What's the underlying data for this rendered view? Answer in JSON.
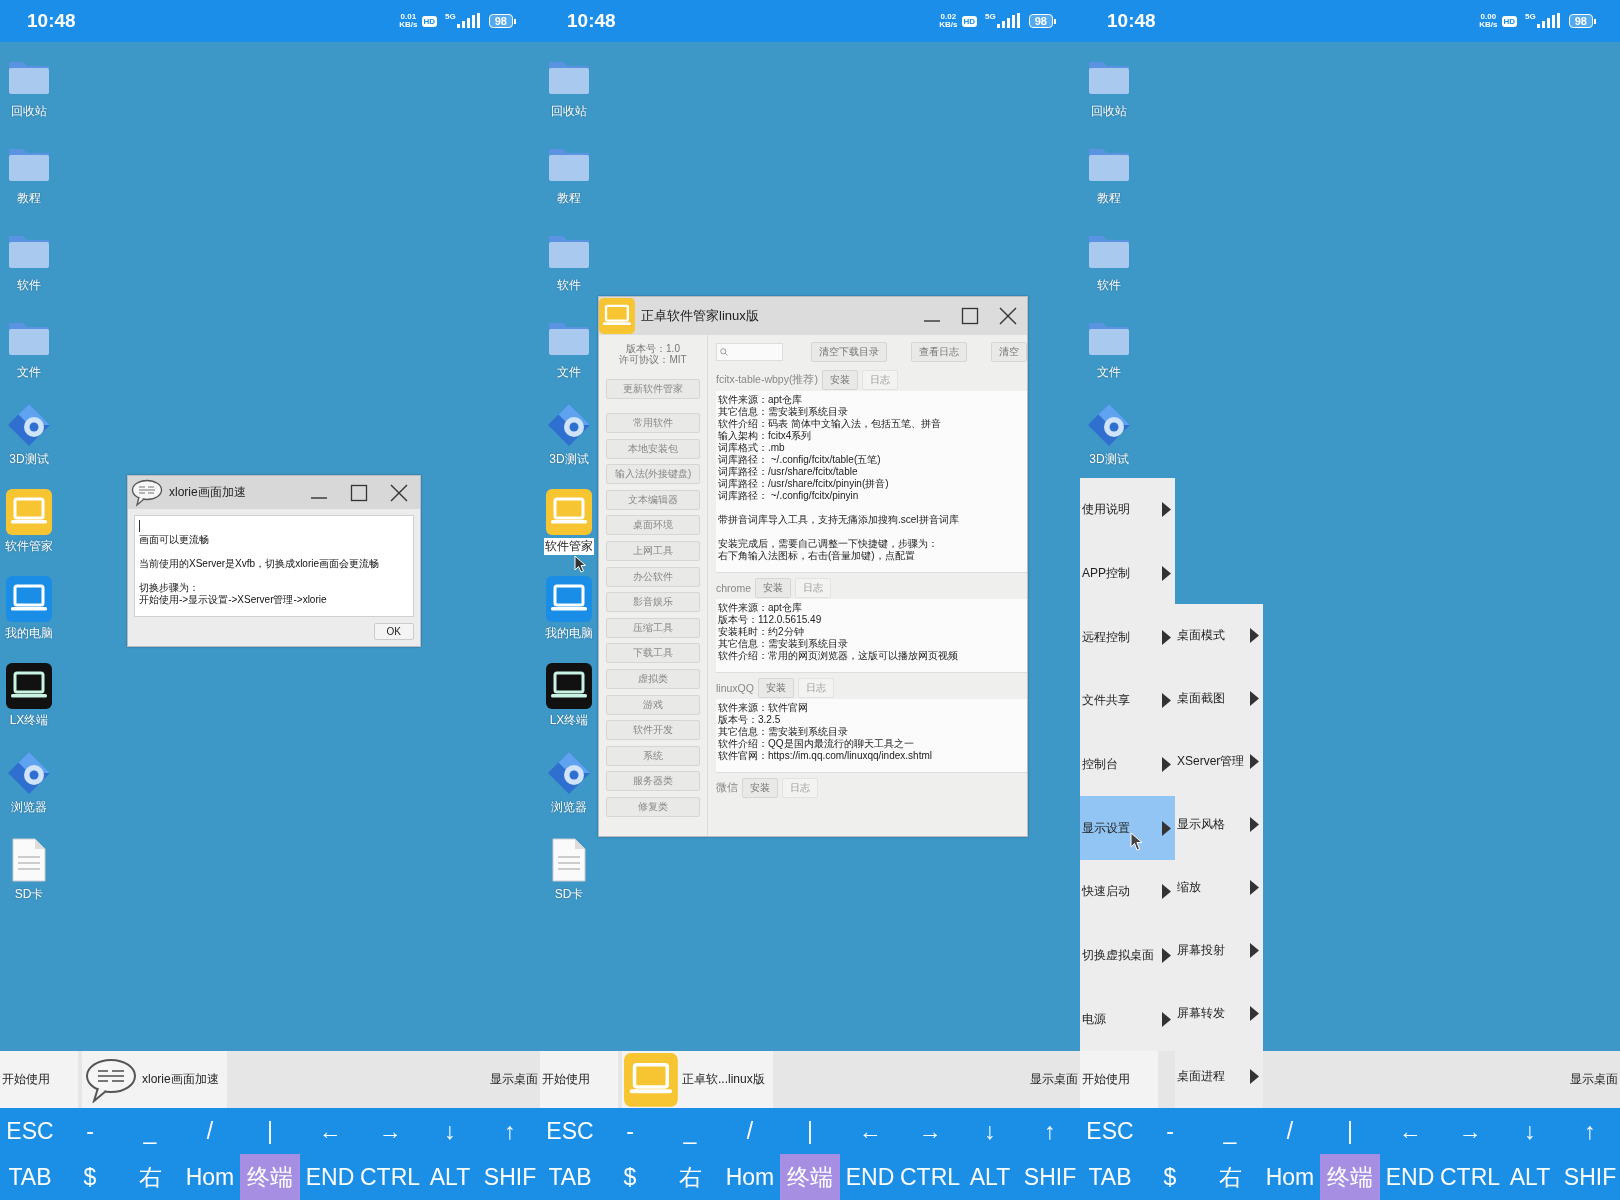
{
  "screens": [
    {
      "status_bar": {
        "time": "10:48",
        "speed": "0.01",
        "speed_unit": "KB/s",
        "hd": "HD",
        "network": "5G",
        "battery": "98"
      },
      "desktop_icons": [
        {
          "label": "回收站",
          "kind": "folder",
          "selected": false
        },
        {
          "label": "教程",
          "kind": "folder",
          "selected": false
        },
        {
          "label": "软件",
          "kind": "folder",
          "selected": false
        },
        {
          "label": "文件",
          "kind": "folder",
          "selected": false
        },
        {
          "label": "3D测试",
          "kind": "gear",
          "selected": false
        },
        {
          "label": "软件管家",
          "kind": "laptop",
          "color": "#f7c531",
          "selected": false
        },
        {
          "label": "我的电脑",
          "kind": "laptop",
          "color": "#1a8ee6",
          "selected": false
        },
        {
          "label": "LX终端",
          "kind": "laptop",
          "color": "#111111",
          "selected": false
        },
        {
          "label": "浏览器",
          "kind": "gear",
          "selected": false
        },
        {
          "label": "SD卡",
          "kind": "file",
          "selected": false
        }
      ],
      "dialog": {
        "title": "xlorie画面加速",
        "paragraphs": [
          [
            "画面可以更流畅"
          ],
          [
            "当前使用的XServer是Xvfb，切换成xlorie画面会更流畅"
          ],
          [
            "切换步骤为：",
            "开始使用->显示设置->XServer管理->xlorie"
          ]
        ],
        "button": "OK"
      },
      "taskbar": {
        "start": "开始使用",
        "tasks": [
          {
            "label": "xlorie画面加速",
            "kind": "chat"
          }
        ],
        "show_desktop": "显示桌面"
      },
      "keyboard": {
        "rows": [
          {
            "keys": [
              {
                "label": "ESC",
                "highlighted": false
              },
              {
                "label": "-",
                "highlighted": false
              },
              {
                "label": "_",
                "highlighted": false
              },
              {
                "label": "/",
                "highlighted": false
              },
              {
                "label": "|",
                "highlighted": false
              },
              {
                "label": "←",
                "highlighted": false
              },
              {
                "label": "→",
                "highlighted": false
              },
              {
                "label": "↓",
                "highlighted": false
              },
              {
                "label": "↑",
                "highlighted": false
              }
            ]
          },
          {
            "keys": [
              {
                "label": "TAB",
                "highlighted": false
              },
              {
                "label": "$",
                "highlighted": false
              },
              {
                "label": "右",
                "highlighted": false
              },
              {
                "label": "Hom",
                "highlighted": false
              },
              {
                "label": "终端",
                "highlighted": true
              },
              {
                "label": "END",
                "highlighted": false
              },
              {
                "label": "CTRL",
                "highlighted": false
              },
              {
                "label": "ALT",
                "highlighted": false
              },
              {
                "label": "SHIF",
                "highlighted": false
              }
            ]
          }
        ]
      }
    },
    {
      "status_bar": {
        "time": "10:48",
        "speed": "0.02",
        "speed_unit": "KB/s",
        "hd": "HD",
        "network": "5G",
        "battery": "98"
      },
      "desktop_icons": [
        {
          "label": "回收站",
          "kind": "folder",
          "selected": false
        },
        {
          "label": "教程",
          "kind": "folder",
          "selected": false
        },
        {
          "label": "软件",
          "kind": "folder",
          "selected": false
        },
        {
          "label": "文件",
          "kind": "folder",
          "selected": false
        },
        {
          "label": "3D测试",
          "kind": "gear",
          "selected": false
        },
        {
          "label": "软件管家",
          "kind": "laptop",
          "color": "#f7c531",
          "selected": true
        },
        {
          "label": "我的电脑",
          "kind": "laptop",
          "color": "#1a8ee6",
          "selected": false
        },
        {
          "label": "LX终端",
          "kind": "laptop",
          "color": "#111111",
          "selected": false
        },
        {
          "label": "浏览器",
          "kind": "gear",
          "selected": false
        },
        {
          "label": "SD卡",
          "kind": "file",
          "selected": false
        }
      ],
      "window": {
        "title": "正卓软件管家linux版",
        "version": "版本号：1.0",
        "license": "许可协议：MIT",
        "update_button": "更新软件管家",
        "categories": [
          "常用软件",
          "本地安装包",
          "输入法(外接键盘)",
          "文本编辑器",
          "桌面环境",
          "上网工具",
          "办公软件",
          "影音娱乐",
          "压缩工具",
          "下载工具",
          "虚拟类",
          "游戏",
          "软件开发",
          "系统",
          "服务器类",
          "修复类"
        ],
        "toolbar": [
          "清空下载目录",
          "查看日志",
          "清空"
        ],
        "packages": [
          {
            "name": "fcitx-table-wbpy(推荐)",
            "buttons": [
              {
                "label": "安装",
                "disabled": false
              },
              {
                "label": "日志",
                "disabled": true
              }
            ],
            "paragraphs": [
              [
                "软件来源：apt仓库",
                "其它信息：需安装到系统目录",
                "软件介绍：码表 简体中文输入法，包括五笔、拼音",
                "输入架构：fcitx4系列",
                "词库格式：.mb",
                "词库路径： ~/.config/fcitx/table(五笔)",
                "词库路径：/usr/share/fcitx/table",
                "词库路径：/usr/share/fcitx/pinyin(拼音)",
                "词库路径： ~/.config/fcitx/pinyin"
              ],
              [
                "带拼音词库导入工具，支持无痛添加搜狗.scel拼音词库"
              ],
              [
                "安装完成后，需要自己调整一下快捷键，步骤为：",
                "右下角输入法图标，右击(音量加键)，点配置"
              ]
            ]
          },
          {
            "name": "chrome",
            "buttons": [
              {
                "label": "安装",
                "disabled": false
              },
              {
                "label": "日志",
                "disabled": true
              }
            ],
            "paragraphs": [
              [
                "软件来源：apt仓库",
                "版本号：112.0.5615.49",
                "安装耗时：约2分钟",
                "其它信息：需安装到系统目录",
                "软件介绍：常用的网页浏览器，这版可以播放网页视频"
              ]
            ]
          },
          {
            "name": "linuxQQ",
            "buttons": [
              {
                "label": "安装",
                "disabled": false
              },
              {
                "label": "日志",
                "disabled": true
              }
            ],
            "paragraphs": [
              [
                "软件来源：软件官网",
                "版本号：3.2.5",
                "其它信息：需安装到系统目录",
                "软件介绍：QQ是国内最流行的聊天工具之一",
                "软件官网：https://im.qq.com/linuxqq/index.shtml"
              ]
            ]
          },
          {
            "name": "微信",
            "buttons": [
              {
                "label": "安装",
                "disabled": false
              },
              {
                "label": "日志",
                "disabled": true
              }
            ]
          }
        ]
      },
      "taskbar": {
        "start": "开始使用",
        "tasks": [
          {
            "label": "正卓软...linux版",
            "kind": "app"
          }
        ],
        "show_desktop": "显示桌面"
      },
      "keyboard": {
        "rows": [
          {
            "keys": [
              {
                "label": "ESC",
                "highlighted": false
              },
              {
                "label": "-",
                "highlighted": false
              },
              {
                "label": "_",
                "highlighted": false
              },
              {
                "label": "/",
                "highlighted": false
              },
              {
                "label": "|",
                "highlighted": false
              },
              {
                "label": "←",
                "highlighted": false
              },
              {
                "label": "→",
                "highlighted": false
              },
              {
                "label": "↓",
                "highlighted": false
              },
              {
                "label": "↑",
                "highlighted": false
              }
            ]
          },
          {
            "keys": [
              {
                "label": "TAB",
                "highlighted": false
              },
              {
                "label": "$",
                "highlighted": false
              },
              {
                "label": "右",
                "highlighted": false
              },
              {
                "label": "Hom",
                "highlighted": false
              },
              {
                "label": "终端",
                "highlighted": true
              },
              {
                "label": "END",
                "highlighted": false
              },
              {
                "label": "CTRL",
                "highlighted": false
              },
              {
                "label": "ALT",
                "highlighted": false
              },
              {
                "label": "SHIF",
                "highlighted": false
              }
            ]
          }
        ]
      }
    },
    {
      "status_bar": {
        "time": "10:48",
        "speed": "0.00",
        "speed_unit": "KB/s",
        "hd": "HD",
        "network": "5G",
        "battery": "98"
      },
      "desktop_icons": [
        {
          "label": "回收站",
          "kind": "folder",
          "selected": false
        },
        {
          "label": "教程",
          "kind": "folder",
          "selected": false
        },
        {
          "label": "软件",
          "kind": "folder",
          "selected": false
        },
        {
          "label": "文件",
          "kind": "folder",
          "selected": false
        },
        {
          "label": "3D测试",
          "kind": "gear",
          "selected": false
        }
      ],
      "start_menu": {
        "items": [
          {
            "label": "使用说明",
            "selected": false
          },
          {
            "label": "APP控制",
            "selected": false
          },
          {
            "label": "远程控制",
            "selected": false
          },
          {
            "label": "文件共享",
            "selected": false
          },
          {
            "label": "控制台",
            "selected": false
          },
          {
            "label": "显示设置",
            "selected": true
          },
          {
            "label": "快速启动",
            "selected": false
          },
          {
            "label": "切换虚拟桌面",
            "selected": false
          },
          {
            "label": "电源",
            "selected": false
          }
        ],
        "submenu": [
          "桌面模式",
          "桌面截图",
          "XServer管理",
          "显示风格",
          "缩放",
          "屏幕投射",
          "屏幕转发",
          "桌面进程"
        ]
      },
      "taskbar": {
        "start": "开始使用",
        "show_desktop": "显示桌面"
      },
      "keyboard": {
        "rows": [
          {
            "keys": [
              {
                "label": "ESC",
                "highlighted": false
              },
              {
                "label": "-",
                "highlighted": false
              },
              {
                "label": "_",
                "highlighted": false
              },
              {
                "label": "/",
                "highlighted": false
              },
              {
                "label": "|",
                "highlighted": false
              },
              {
                "label": "←",
                "highlighted": false
              },
              {
                "label": "→",
                "highlighted": false
              },
              {
                "label": "↓",
                "highlighted": false
              },
              {
                "label": "↑",
                "highlighted": false
              }
            ]
          },
          {
            "keys": [
              {
                "label": "TAB",
                "highlighted": false
              },
              {
                "label": "$",
                "highlighted": false
              },
              {
                "label": "右",
                "highlighted": false
              },
              {
                "label": "Hom",
                "highlighted": false
              },
              {
                "label": "终端",
                "highlighted": true
              },
              {
                "label": "END",
                "highlighted": false
              },
              {
                "label": "CTRL",
                "highlighted": false
              },
              {
                "label": "ALT",
                "highlighted": false
              },
              {
                "label": "SHIF",
                "highlighted": false
              }
            ]
          }
        ]
      }
    }
  ]
}
